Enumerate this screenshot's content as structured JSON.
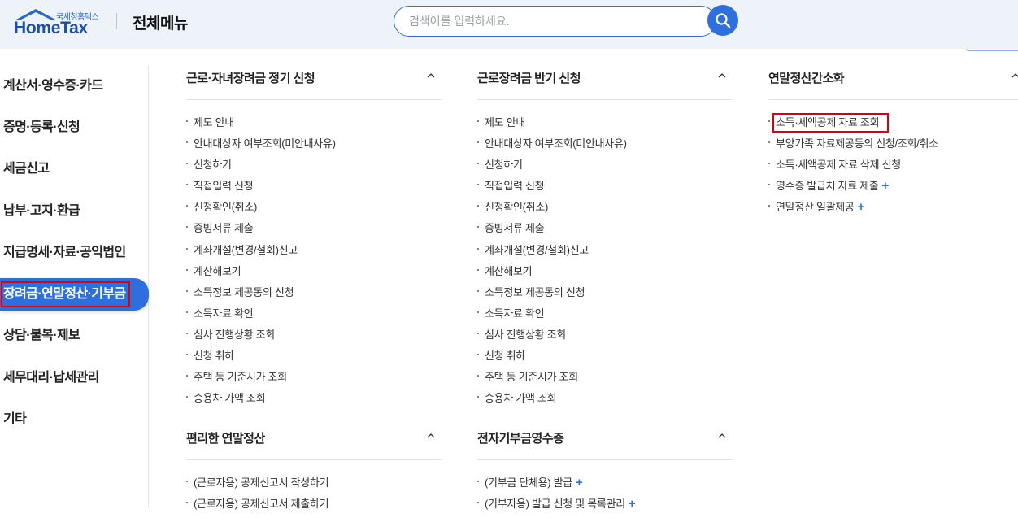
{
  "header": {
    "logo_sub": "국세청홈택스",
    "logo_main": "HomeTax",
    "title": "전체메뉴",
    "search_placeholder": "검색어를 입력하세요.",
    "search_icon": "search-icon",
    "accent_color": "#2e6fe0"
  },
  "sidebar": {
    "items": [
      {
        "label": "계산서·영수증·카드"
      },
      {
        "label": "증명·등록·신청"
      },
      {
        "label": "세금신고"
      },
      {
        "label": "납부·고지·환급"
      },
      {
        "label": "지급명세·자료·공익법인"
      },
      {
        "label": "장려금·연말정산·기부금",
        "active": true
      },
      {
        "label": "상담·불복·제보"
      },
      {
        "label": "세무대리·납세관리"
      },
      {
        "label": "기타"
      }
    ]
  },
  "sections": {
    "s1": {
      "title": "근로·자녀장려금 정기 신청",
      "items": [
        "제도 안내",
        "안내대상자 여부조회(미안내사유)",
        "신청하기",
        "직접입력 신청",
        "신청확인(취소)",
        "증빙서류 제출",
        "계좌개설(변경/철회)신고",
        "계산해보기",
        "소득정보 제공동의 신청",
        "소득자료 확인",
        "심사 진행상황 조회",
        "신청 취하",
        "주택 등 기준시가 조회",
        "승용차 가액 조회"
      ]
    },
    "s2": {
      "title": "근로장려금 반기 신청",
      "items": [
        "제도 안내",
        "안내대상자 여부조회(미안내사유)",
        "신청하기",
        "직접입력 신청",
        "신청확인(취소)",
        "증빙서류 제출",
        "계좌개설(변경/철회)신고",
        "계산해보기",
        "소득정보 제공동의 신청",
        "소득자료 확인",
        "심사 진행상황 조회",
        "신청 취하",
        "주택 등 기준시가 조회",
        "승용차 가액 조회"
      ]
    },
    "s3": {
      "title": "연말정산간소화",
      "items": [
        "소득·세액공제 자료 조회",
        "부양가족 자료제공동의 신청/조회/취소",
        "소득·세액공제 자료 삭제 신청",
        "영수증 발급처 자료 제출",
        "연말정산 일괄제공"
      ],
      "plus": "+"
    },
    "s4": {
      "title": "편리한 연말정산",
      "items": [
        "(근로자용) 공제신고서 작성하기",
        "(근로자용) 공제신고서 제출하기"
      ]
    },
    "s5": {
      "title": "전자기부금영수증",
      "items": [
        "(기부금 단체용) 발급",
        "(기부자용) 발급 신청 및 목록관리"
      ],
      "plus": "+"
    }
  }
}
